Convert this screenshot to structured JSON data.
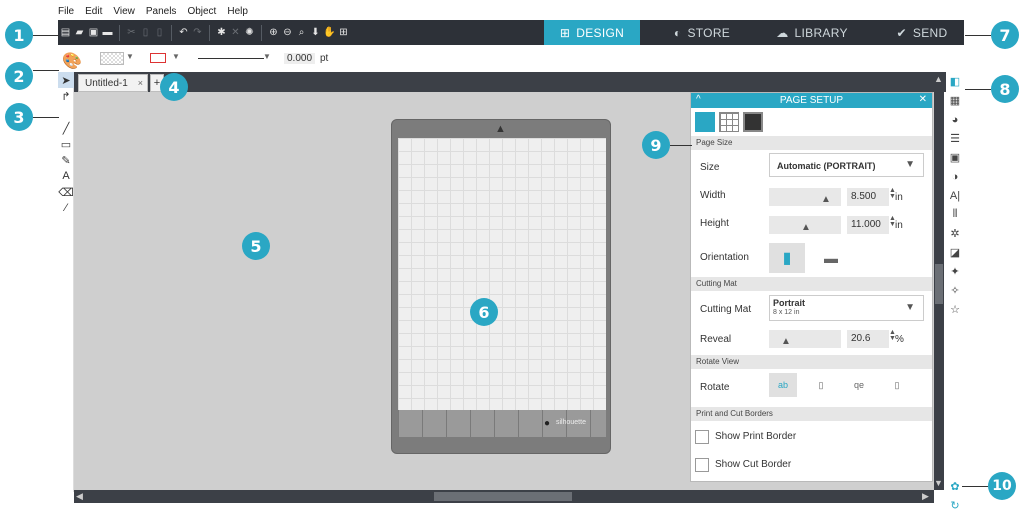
{
  "menu": [
    "File",
    "Edit",
    "View",
    "Panels",
    "Object",
    "Help"
  ],
  "nav_tabs": [
    {
      "label": "DESIGN",
      "icon": "grid-icon"
    },
    {
      "label": "STORE",
      "icon": "store-icon"
    },
    {
      "label": "LIBRARY",
      "icon": "cloud-icon"
    },
    {
      "label": "SEND",
      "icon": "check-circle-icon"
    }
  ],
  "toolbar2": {
    "line_width": "0.000",
    "line_unit": "pt"
  },
  "doc_tab": {
    "title": "Untitled-1",
    "close": "×",
    "add": "+"
  },
  "callouts": [
    "1",
    "2",
    "3",
    "4",
    "5",
    "6",
    "7",
    "8",
    "9",
    "10"
  ],
  "panel": {
    "title": "PAGE SETUP",
    "sections": {
      "page_size": "Page Size",
      "cutting_mat": "Cutting Mat",
      "rotate_view": "Rotate View",
      "print_cut": "Print and Cut Borders"
    },
    "size_label": "Size",
    "size_value": "Automatic (PORTRAIT)",
    "width_label": "Width",
    "width_value": "8.500",
    "width_unit": "in",
    "height_label": "Height",
    "height_value": "11.000",
    "height_unit": "in",
    "orientation_label": "Orientation",
    "mat_label": "Cutting Mat",
    "mat_value": "Portrait",
    "mat_sub": "8 x 12 in",
    "reveal_label": "Reveal",
    "reveal_value": "20.6",
    "reveal_unit": "%",
    "rotate_label": "Rotate",
    "show_print_border": "Show Print Border",
    "show_cut_border": "Show Cut Border"
  },
  "mat_brand": "silhouette",
  "colors": {
    "accent": "#2aa7c4",
    "toolbar": "#2d3138",
    "canvas": "#cfcfcf"
  }
}
